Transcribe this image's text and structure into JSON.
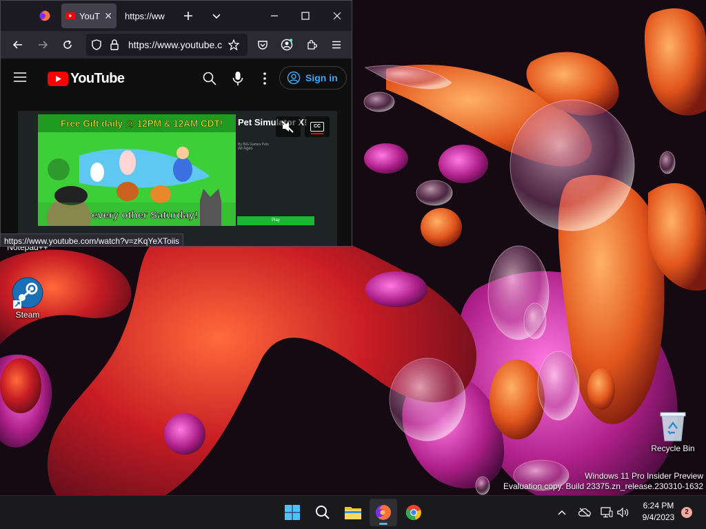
{
  "desktop": {
    "icons": [
      {
        "label": "Notepad++"
      },
      {
        "label": "Steam"
      },
      {
        "label": "Recycle Bin"
      }
    ],
    "watermark": {
      "line1": "Windows 11 Pro Insider Preview",
      "line2": "Evaluation copy. Build 23375.zn_release.230310-1632"
    }
  },
  "browser": {
    "tabs": [
      {
        "label": "YouT"
      },
      {
        "label": "https://ww"
      }
    ],
    "address": "https://www.youtube.c",
    "status_url": "https://www.youtube.com/watch?v=zKqYeXToiis"
  },
  "youtube": {
    "logo_text": "YouTube",
    "sign_in": "Sign in",
    "video": {
      "banner_text": "Free Gift daily @ 12PM & 12AM CDT!",
      "bottom_text": "every other Saturday!",
      "game_title": "Pet Simulator X!",
      "game_by": "By BIG Games Pets",
      "game_age": "All Ages",
      "play_label": "Play",
      "cc_label": "CC"
    }
  },
  "taskbar": {
    "time": "6:24 PM",
    "date": "9/4/2023",
    "notification_count": "2"
  },
  "colors": {
    "accent": "#3ea6ff",
    "youtube_red": "#ff0000",
    "taskbar_bg": "#1a1a1d"
  }
}
